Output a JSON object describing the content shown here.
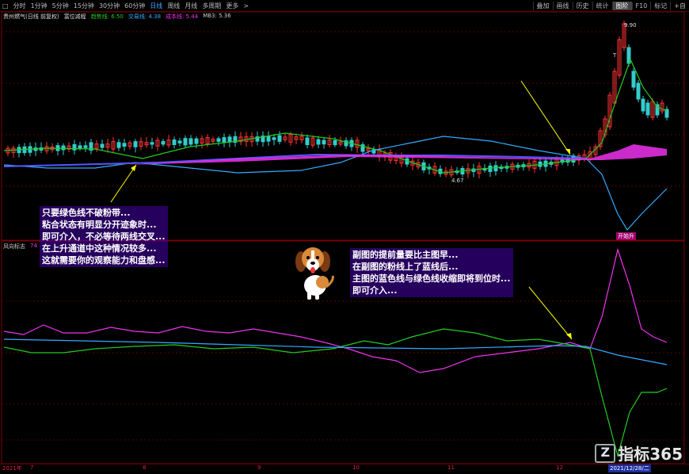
{
  "toolbar": {
    "left_items": [
      "□",
      "分时",
      "1分钟",
      "5分钟",
      "15分钟",
      "30分钟",
      "60分钟",
      "日线",
      "周线",
      "月线",
      "多周期",
      "更多",
      ">"
    ],
    "active_index": 7,
    "right_items": [
      "叠加",
      "画线",
      "历史",
      "统计",
      "图阶",
      "F10",
      "标记",
      "+自"
    ],
    "right_active_index": 4
  },
  "main_legend": {
    "title": "贵州燃气(日线 前复权)",
    "indicator": "富位减程",
    "items": [
      {
        "label": "趋势线: 6.50",
        "color": "#22cc22"
      },
      {
        "label": "交易线: 4.38",
        "color": "#33aaff"
      },
      {
        "label": "成本线: 5.44",
        "color": "#ee33ee"
      },
      {
        "label": "MB3: 5.36",
        "color": "#cccccc"
      }
    ]
  },
  "sub_legend": {
    "title": "风向标志",
    "value": "74"
  },
  "price_labels": {
    "high": "9.90",
    "low": "4.67",
    "marker": "T"
  },
  "badges": {
    "main_bottom": "开始升"
  },
  "annotations": {
    "left": [
      "只要绿色线不破粉带...",
      "粘合状态有明显分开迹象时...",
      "即可介入，不必等待两线交叉...",
      "在上升通道中这种情况较多...",
      "这就需要你的观察能力和盘感..."
    ],
    "right": [
      "副图的提前量要比主图早...",
      "在副图的粉线上了蓝线后...",
      "主图的蓝色线与绿色线收缩即将到位时...",
      "即可介入..."
    ]
  },
  "dates": {
    "first": "2021年",
    "months": [
      "7",
      "8",
      "9",
      "10",
      "11",
      "12"
    ],
    "selected": "2021/12/28/二"
  },
  "watermark": {
    "logo": "Z",
    "text": "指标365"
  },
  "colors": {
    "green": "#22cc22",
    "blue": "#33aaff",
    "magenta": "#ee33ee",
    "up": "#ff3333",
    "down": "#33cccc",
    "annotation_bg": "#4600aa",
    "arrow": "#ffff00"
  }
}
